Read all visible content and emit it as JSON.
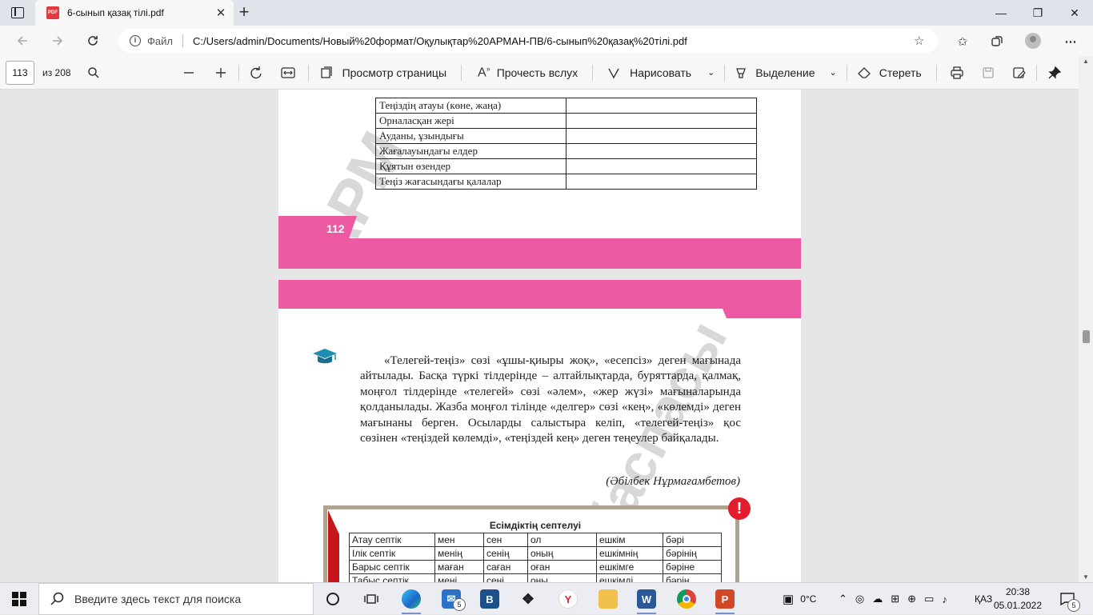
{
  "browser": {
    "tab_title": "6-сынып қазақ тілі.pdf",
    "tab_close": "✕",
    "new_tab": "+",
    "address_scheme": "Файл",
    "address_url": "C:/Users/admin/Documents/Новый%20формат/Оқулықтар%20АРМАН-ПВ/6-сынып%20қазақ%20тілі.pdf",
    "minimize": "—",
    "maximize": "❐",
    "close": "✕"
  },
  "pdf_toolbar": {
    "page_current": "113",
    "page_total": "из 208",
    "page_view_label": "Просмотр страницы",
    "read_aloud_label": "Прочесть вслух",
    "draw_label": "Нарисовать",
    "highlight_label": "Выделение",
    "erase_label": "Стереть"
  },
  "page112": {
    "table_rows": [
      "Теңіздің атауы (көне, жаңа)",
      "Орналасқан жері",
      "Ауданы, ұзындығы",
      "Жағалауындағы елдер",
      "Құятын өзендер",
      "Теңіз жағасындағы қалалар"
    ],
    "page_number": "112",
    "watermark": "АРМ"
  },
  "page113": {
    "paragraph": "«Телегей-теңіз» сөзі «ұшы-қиыры жоқ», «есепсіз» деген мағынада айтылады. Басқа түркі тілдерінде – алтайлықтарда, буряттарда, қалмақ, моңғол тілдерінде «телегей» сөзі «әлем», «жер жүзі» мағыналарында қолданылады. Жазба моңғол тілінде «делгер» сөзі «кең», «көлемді» деген мағынаны берген. Осыларды салыстыра келіп, «телегей-теңіз» қос сөзінен «теңіздей көлемді», «теңіздей кең» деген теңеулер байқалады.",
    "author": "(Әбілбек Нұрмағамбетов)",
    "watermark": "баспасы",
    "exclamation": "!",
    "case_table_title": "Есімдіктің септелуі",
    "case_table_rows": [
      [
        "Атау септік",
        "мен",
        "сен",
        "ол",
        "ешкім",
        "бәрі"
      ],
      [
        "Ілік септік",
        "менің",
        "сенің",
        "оның",
        "ешкімнің",
        "бәрінің"
      ],
      [
        "Барыс септік",
        "маған",
        "саған",
        "оған",
        "ешкімге",
        "бәріне"
      ],
      [
        "Табыс септік",
        "мені",
        "сені",
        "оны",
        "ешкімді",
        "бәрін"
      ]
    ]
  },
  "taskbar": {
    "search_placeholder": "Введите здесь текст для поиска",
    "mail_badge": "5",
    "notif_badge": "5",
    "temperature": "0°C",
    "language": "ҚАЗ",
    "time": "20:38",
    "date": "05.01.2022"
  },
  "colors": {
    "pink_band": "#ed5aa4",
    "red_accent": "#c5161d",
    "frame": "#b0a490"
  }
}
